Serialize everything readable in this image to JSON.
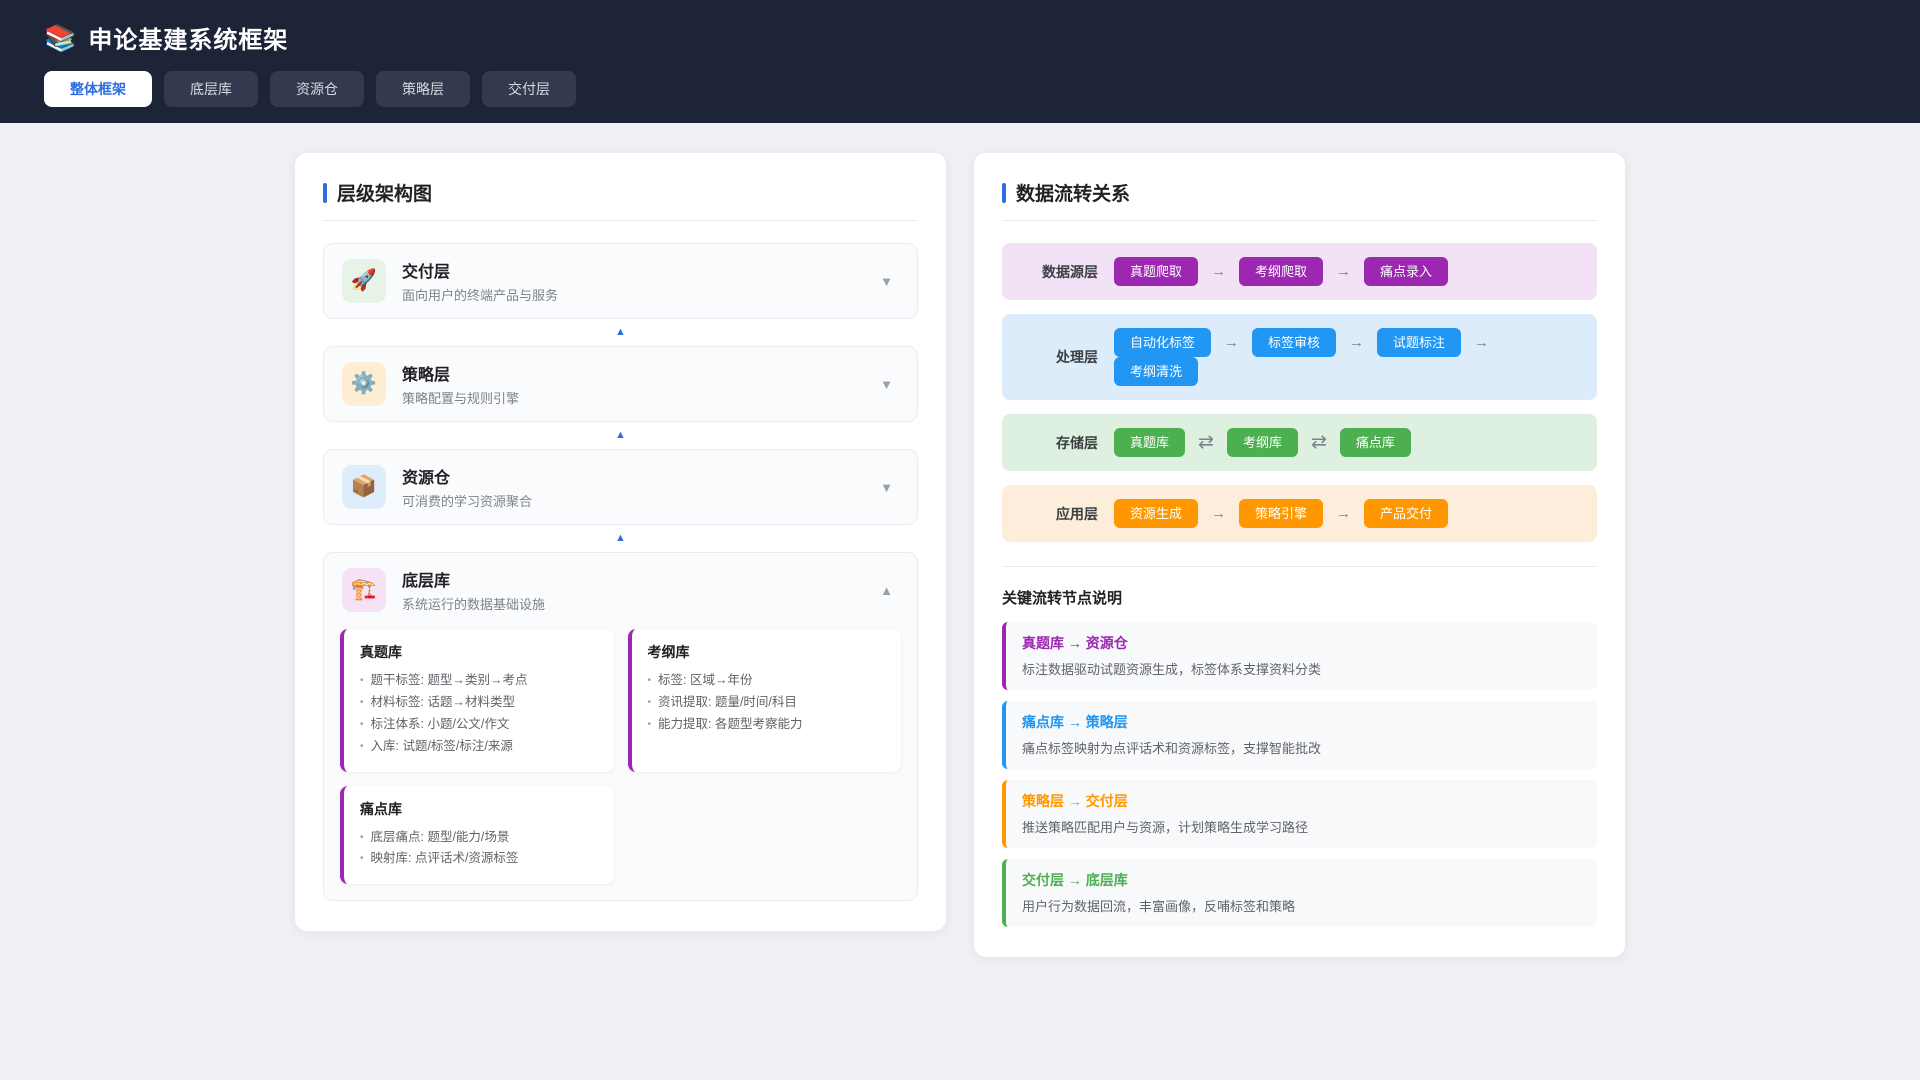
{
  "header": {
    "logo_icon": "books-stack",
    "logo_glyph": "📚",
    "title": "申论基建系统框架",
    "tabs": [
      {
        "label": "整体框架",
        "active": true
      },
      {
        "label": "底层库",
        "active": false
      },
      {
        "label": "资源仓",
        "active": false
      },
      {
        "label": "策略层",
        "active": false
      },
      {
        "label": "交付层",
        "active": false
      }
    ]
  },
  "left_panel": {
    "title": "层级架构图",
    "connector_glyph": "▲",
    "chevron_collapsed": "▼",
    "chevron_expanded": "▲",
    "layers": [
      {
        "icon": "rocket-icon",
        "glyph": "🚀",
        "icon_bg": "#e6f3e6",
        "name": "交付层",
        "desc": "面向用户的终端产品与服务",
        "expanded": false
      },
      {
        "icon": "gear-icon",
        "glyph": "⚙️",
        "icon_bg": "#fdeed3",
        "name": "策略层",
        "desc": "策略配置与规则引擎",
        "expanded": false
      },
      {
        "icon": "package-icon",
        "glyph": "📦",
        "icon_bg": "#ddedfb",
        "name": "资源仓",
        "desc": "可消费的学习资源聚合",
        "expanded": false
      },
      {
        "icon": "crane-icon",
        "glyph": "🏗️",
        "icon_bg": "#f6e2f6",
        "name": "底层库",
        "desc": "系统运行的数据基础设施",
        "expanded": true,
        "accent": "#9c27b0",
        "sub_cards": [
          {
            "title": "真题库",
            "bullets": [
              "题干标签: 题型→类别→考点",
              "材料标签: 话题→材料类型",
              "标注体系: 小题/公文/作文",
              "入库: 试题/标签/标注/来源"
            ]
          },
          {
            "title": "考纲库",
            "bullets": [
              "标签: 区域→年份",
              "资讯提取: 题量/时间/科目",
              "能力提取: 各题型考察能力"
            ]
          },
          {
            "title": "痛点库",
            "bullets": [
              "底层痛点: 题型/能力/场景",
              "映射库: 点评话术/资源标签"
            ]
          }
        ]
      }
    ]
  },
  "right_panel": {
    "title": "数据流转关系",
    "flows": [
      {
        "label": "数据源层",
        "row_bg": "#f3e1f6",
        "badge_color": "#9c27b0",
        "arrow": "→",
        "nodes": [
          "真题爬取",
          "考纲爬取",
          "痛点录入"
        ]
      },
      {
        "label": "处理层",
        "row_bg": "#dcecfb",
        "badge_color": "#2196f3",
        "arrow": "→",
        "nodes": [
          "自动化标签",
          "标签审核",
          "试题标注",
          "考纲清洗"
        ]
      },
      {
        "label": "存储层",
        "row_bg": "#def0df",
        "badge_color": "#4caf50",
        "arrow": "⇄",
        "nodes": [
          "真题库",
          "考纲库",
          "痛点库"
        ]
      },
      {
        "label": "应用层",
        "row_bg": "#fdeedc",
        "badge_color": "#ff9800",
        "arrow": "→",
        "nodes": [
          "资源生成",
          "策略引擎",
          "产品交付"
        ]
      }
    ],
    "notes_title": "关键流转节点说明",
    "notes": [
      {
        "title": "真题库 → 资源仓",
        "color": "#9c27b0",
        "desc": "标注数据驱动试题资源生成，标签体系支撑资料分类"
      },
      {
        "title": "痛点库 → 策略层",
        "color": "#2196f3",
        "desc": "痛点标签映射为点评话术和资源标签，支撑智能批改"
      },
      {
        "title": "策略层 → 交付层",
        "color": "#ff9800",
        "desc": "推送策略匹配用户与资源，计划策略生成学习路径"
      },
      {
        "title": "交付层 → 底层库",
        "color": "#4caf50",
        "desc": "用户行为数据回流，丰富画像，反哺标签和策略"
      }
    ]
  }
}
